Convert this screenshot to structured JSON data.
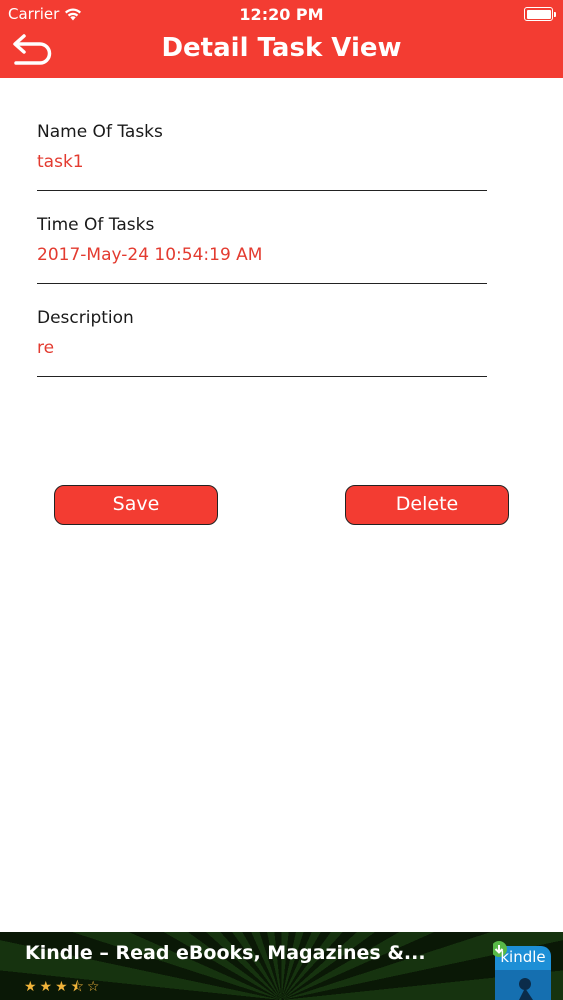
{
  "status_bar": {
    "carrier": "Carrier",
    "time": "12:20 PM"
  },
  "header": {
    "title": "Detail Task View",
    "back_icon": "back-arrow-icon",
    "color": "#f33c32"
  },
  "fields": {
    "name": {
      "label": "Name Of Tasks",
      "value": "task1"
    },
    "time": {
      "label": "Time Of Tasks",
      "value": "2017-May-24 10:54:19 AM"
    },
    "description": {
      "label": "Description",
      "value": "re"
    }
  },
  "buttons": {
    "save": "Save",
    "delete": "Delete"
  },
  "ad": {
    "title": "Kindle – Read eBooks, Magazines &...",
    "rating": 3.5,
    "stars_text": "★★★⯪☆",
    "icon_text": "kindle"
  }
}
